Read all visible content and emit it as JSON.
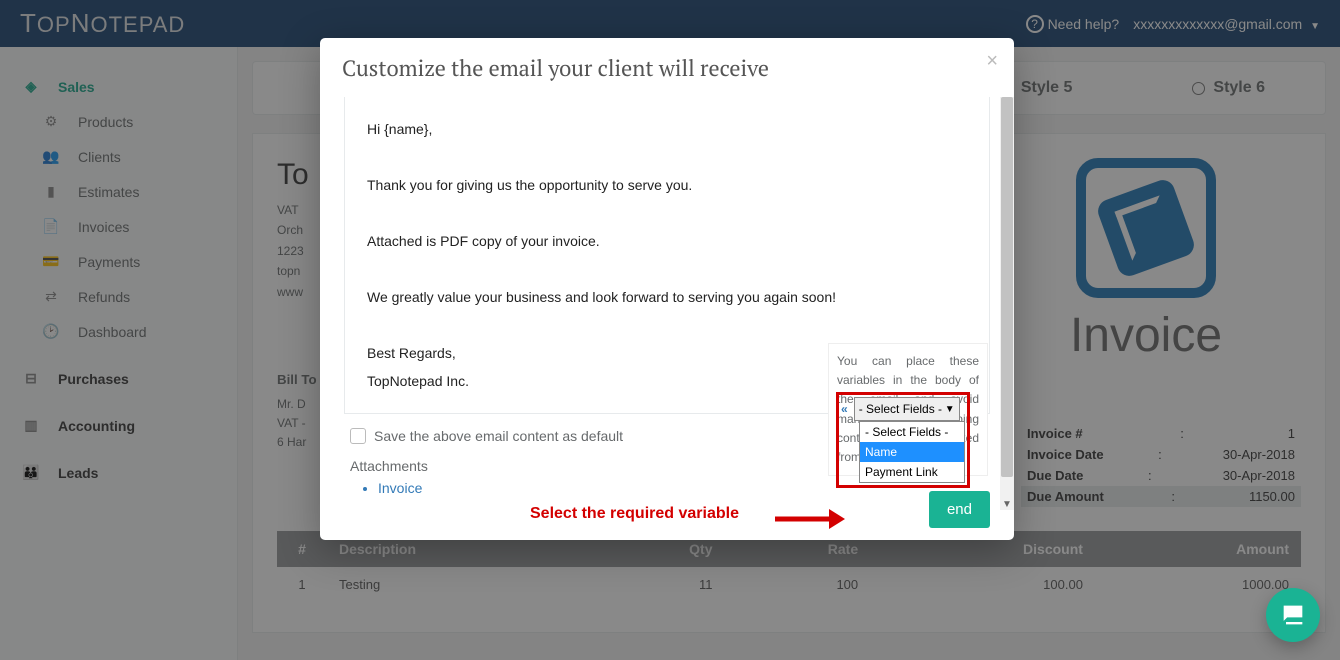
{
  "topbar": {
    "logo_big": "T",
    "logo_rest": "OP",
    "logo_big2": "N",
    "logo_rest2": "OTEPAD",
    "help_label": "Need help?",
    "user_email": "xxxxxxxxxxxxx@gmail.com"
  },
  "sidebar": {
    "groups": [
      {
        "label": "Sales",
        "icon": "layers-icon",
        "active": true,
        "sub": [
          {
            "label": "Products",
            "icon": "cubes-icon"
          },
          {
            "label": "Clients",
            "icon": "users-icon"
          },
          {
            "label": "Estimates",
            "icon": "file-icon"
          },
          {
            "label": "Invoices",
            "icon": "page-icon"
          },
          {
            "label": "Payments",
            "icon": "card-icon"
          },
          {
            "label": "Refunds",
            "icon": "swap-icon"
          },
          {
            "label": "Dashboard",
            "icon": "gauge-icon"
          }
        ]
      },
      {
        "label": "Purchases",
        "icon": "minus-box-icon"
      },
      {
        "label": "Accounting",
        "icon": "bar-icon"
      },
      {
        "label": "Leads",
        "icon": "people-icon"
      }
    ]
  },
  "styles": {
    "style5": "Style 5",
    "style6": "Style 6"
  },
  "invoice": {
    "company": "To",
    "vat_line": "VAT",
    "addr1": "Orch",
    "addr2": "1223",
    "addr3": "topn",
    "addr4": "www",
    "word": "Invoice",
    "kv": [
      {
        "k": "Invoice #",
        "v": "1"
      },
      {
        "k": "Invoice Date",
        "v": "30-Apr-2018"
      },
      {
        "k": "Due Date",
        "v": "30-Apr-2018"
      },
      {
        "k": "Due Amount",
        "v": "1150.00",
        "hl": true
      }
    ],
    "billto_title": "Bill To",
    "billto": [
      "Mr. D",
      "VAT -",
      "6 Har"
    ],
    "cols": [
      "#",
      "Description",
      "Qty",
      "Rate",
      "Discount",
      "Amount"
    ],
    "rows": [
      [
        "1",
        "Testing",
        "11",
        "100",
        "100.00",
        "1000.00"
      ]
    ]
  },
  "modal": {
    "title": "Customize the email your client will receive",
    "body": [
      "Hi {name},",
      "Thank you for giving us the opportunity to serve you.",
      "Attached is PDF copy of your invoice.",
      "We greatly value your business and look forward to serving you again soon!",
      "Best Regards,",
      "TopNotepad Inc."
    ],
    "save_default": "Save the above email content as default",
    "attachments_title": "Attachments",
    "attachments": [
      "Invoice"
    ],
    "send_label": "end",
    "var_tip": "You can place these variables in the body of the email and avoid manual work of typing content that can be picked from the data.",
    "select_placeholder": "- Select Fields -",
    "dropdown": [
      "- Select Fields -",
      "Name",
      "Payment Link"
    ],
    "chev": "«"
  },
  "annotation": {
    "text": "Select the required variable"
  }
}
